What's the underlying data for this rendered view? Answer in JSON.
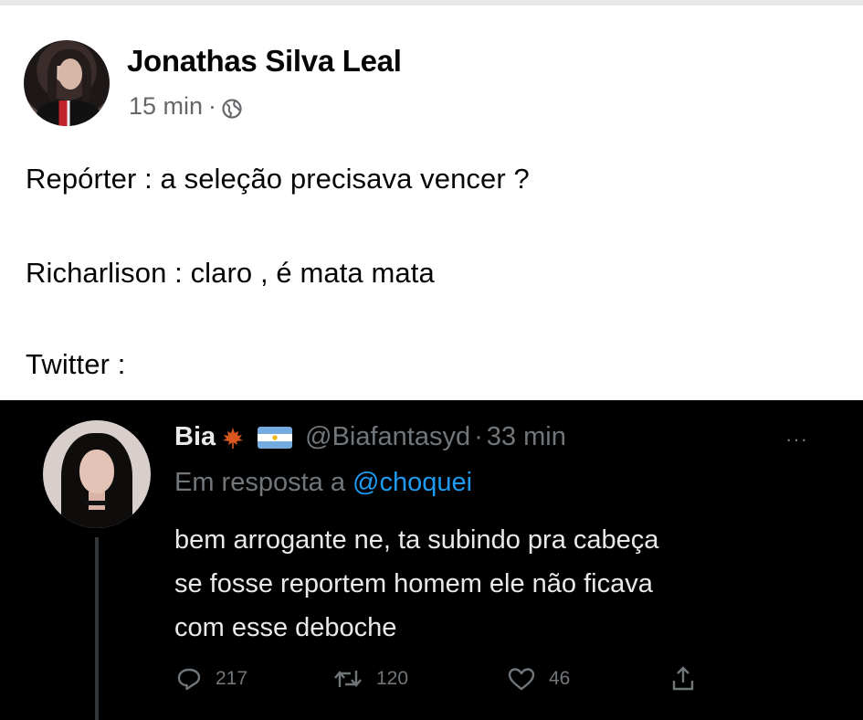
{
  "fb_post": {
    "author": "Jonathas Silva Leal",
    "time": "15 min",
    "separator": "·",
    "privacy_icon": "globe-icon",
    "lines": [
      "Repórter : a seleção precisava vencer ?",
      "Richarlison : claro , é mata mata",
      "Twitter :"
    ]
  },
  "tweet": {
    "name": "Bia",
    "badges": [
      "maple-leaf-emoji",
      "argentina-flag-emoji"
    ],
    "handle": "@Biafantasyd",
    "separator": "·",
    "time": "33 min",
    "more": "···",
    "reply_prefix": "Em resposta a",
    "reply_handle": "@choquei",
    "body": [
      "bem arrogante ne, ta subindo pra cabeça",
      "se fosse reportem homem ele não ficava",
      "com esse deboche"
    ],
    "actions": {
      "replies": "217",
      "retweets": "120",
      "likes": "46"
    },
    "colors": {
      "background": "#000000",
      "text": "#e7e9ea",
      "muted": "#71767b",
      "link": "#1d9bf0"
    }
  }
}
